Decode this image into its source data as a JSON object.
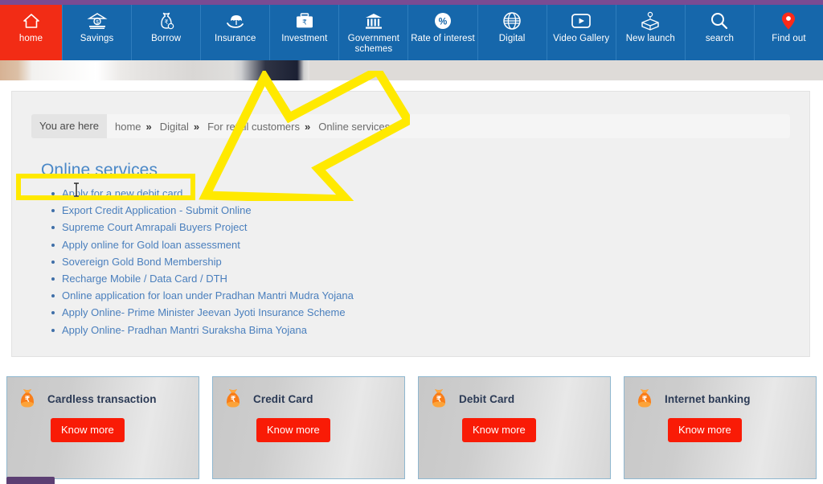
{
  "nav": {
    "items": [
      {
        "label": "home",
        "icon": "home-icon",
        "active": true
      },
      {
        "label": "Savings",
        "icon": "savings-bank-icon",
        "active": false
      },
      {
        "label": "Borrow",
        "icon": "money-bag-icon",
        "active": false
      },
      {
        "label": "Insurance",
        "icon": "umbrella-hand-icon",
        "active": false
      },
      {
        "label": "Investment",
        "icon": "briefcase-rupee-icon",
        "active": false
      },
      {
        "label": "Government schemes",
        "icon": "bank-building-icon",
        "active": false
      },
      {
        "label": "Rate of interest",
        "icon": "percent-icon",
        "active": false
      },
      {
        "label": "Digital",
        "icon": "globe-icon",
        "active": false
      },
      {
        "label": "Video Gallery",
        "icon": "video-play-icon",
        "active": false
      },
      {
        "label": "New launch",
        "icon": "open-box-idea-icon",
        "active": false
      },
      {
        "label": "search",
        "icon": "search-icon",
        "active": false
      },
      {
        "label": "Find out",
        "icon": "map-pin-icon",
        "active": false
      }
    ],
    "colors": {
      "bar": "#1667ab",
      "active": "#f22c15",
      "top_strip": "#7a4b93"
    }
  },
  "breadcrumb": {
    "label": "You are here",
    "separator": "»",
    "items": [
      {
        "text": "home"
      },
      {
        "text": "Digital"
      },
      {
        "text": "For retail customers"
      },
      {
        "text": "Online services"
      }
    ]
  },
  "main": {
    "title": "Online services",
    "links": [
      "Apply for a new debit card",
      "Export Credit Application - Submit Online",
      "Supreme Court Amrapali Buyers Project",
      "Apply online for Gold loan assessment",
      "Sovereign Gold Bond Membership",
      "Recharge Mobile / Data Card / DTH",
      "Online application for loan under Pradhan Mantri Mudra Yojana",
      "Apply Online- Prime Minister Jeevan Jyoti Insurance Scheme",
      "Apply Online- Pradhan Mantri Suraksha Bima Yojana"
    ],
    "link_color": "#4a7fbd",
    "title_color": "#4a88c7"
  },
  "cards": [
    {
      "title": "Cardless transaction",
      "button": "Know more",
      "icon": "money-bag-rupee-icon"
    },
    {
      "title": "Credit Card",
      "button": "Know more",
      "icon": "money-bag-rupee-icon"
    },
    {
      "title": "Debit Card",
      "button": "Know more",
      "icon": "money-bag-rupee-icon"
    },
    {
      "title": "Internet banking",
      "button": "Know more",
      "icon": "money-bag-rupee-icon"
    }
  ],
  "card_style": {
    "button_color": "#f91b06",
    "border_color": "#8fb7cf",
    "icon_color": "#f97d18"
  },
  "annotations": {
    "highlight_color": "#ffe900",
    "arrow": {
      "name": "yellow-arrow-pointing-to-link",
      "target": "Apply for a new debit card"
    },
    "box": {
      "name": "yellow-highlight-box",
      "target": "Apply for a new debit card"
    }
  },
  "cursor": {
    "type": "text-ibeam-cursor"
  }
}
